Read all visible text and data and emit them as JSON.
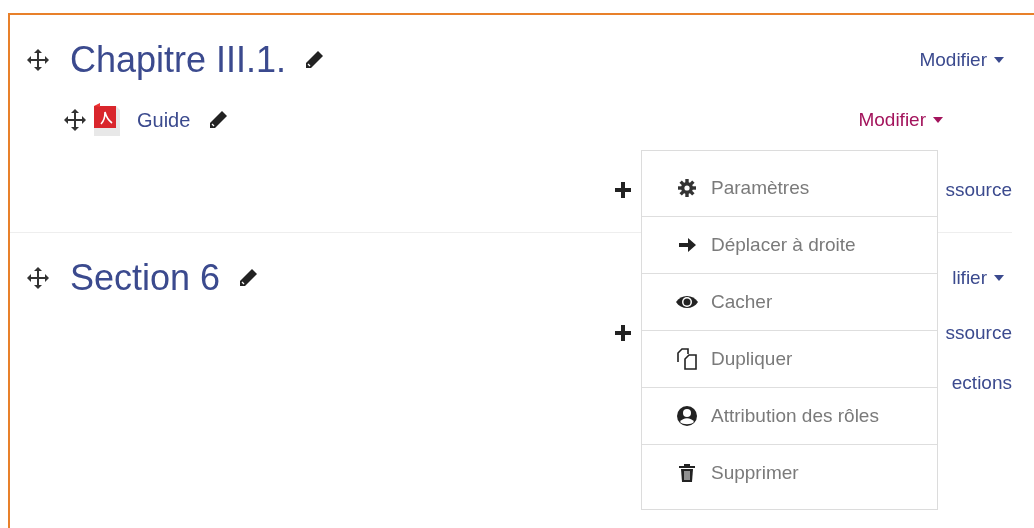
{
  "sections": [
    {
      "title": "Chapitre III.1.",
      "edit_menu": {
        "label": "Modifier",
        "active": false
      },
      "activities": [
        {
          "kind": "pdf",
          "name": "Guide",
          "edit_menu": {
            "label": "Modifier",
            "active": true
          }
        }
      ],
      "add_links": [
        "ssource"
      ]
    },
    {
      "title": "Section 6",
      "edit_menu": {
        "label": "lifier",
        "active": false
      },
      "add_links": [
        "ssource",
        "ections"
      ]
    }
  ],
  "dropdown_menu": {
    "items": [
      {
        "kind": "settings",
        "label": "Paramètres"
      },
      {
        "kind": "move-right",
        "label": "Déplacer à droite"
      },
      {
        "kind": "hide",
        "label": "Cacher"
      },
      {
        "kind": "duplicate",
        "label": "Dupliquer"
      },
      {
        "kind": "roles",
        "label": "Attribution des rôles"
      },
      {
        "kind": "delete",
        "label": "Supprimer"
      }
    ]
  }
}
